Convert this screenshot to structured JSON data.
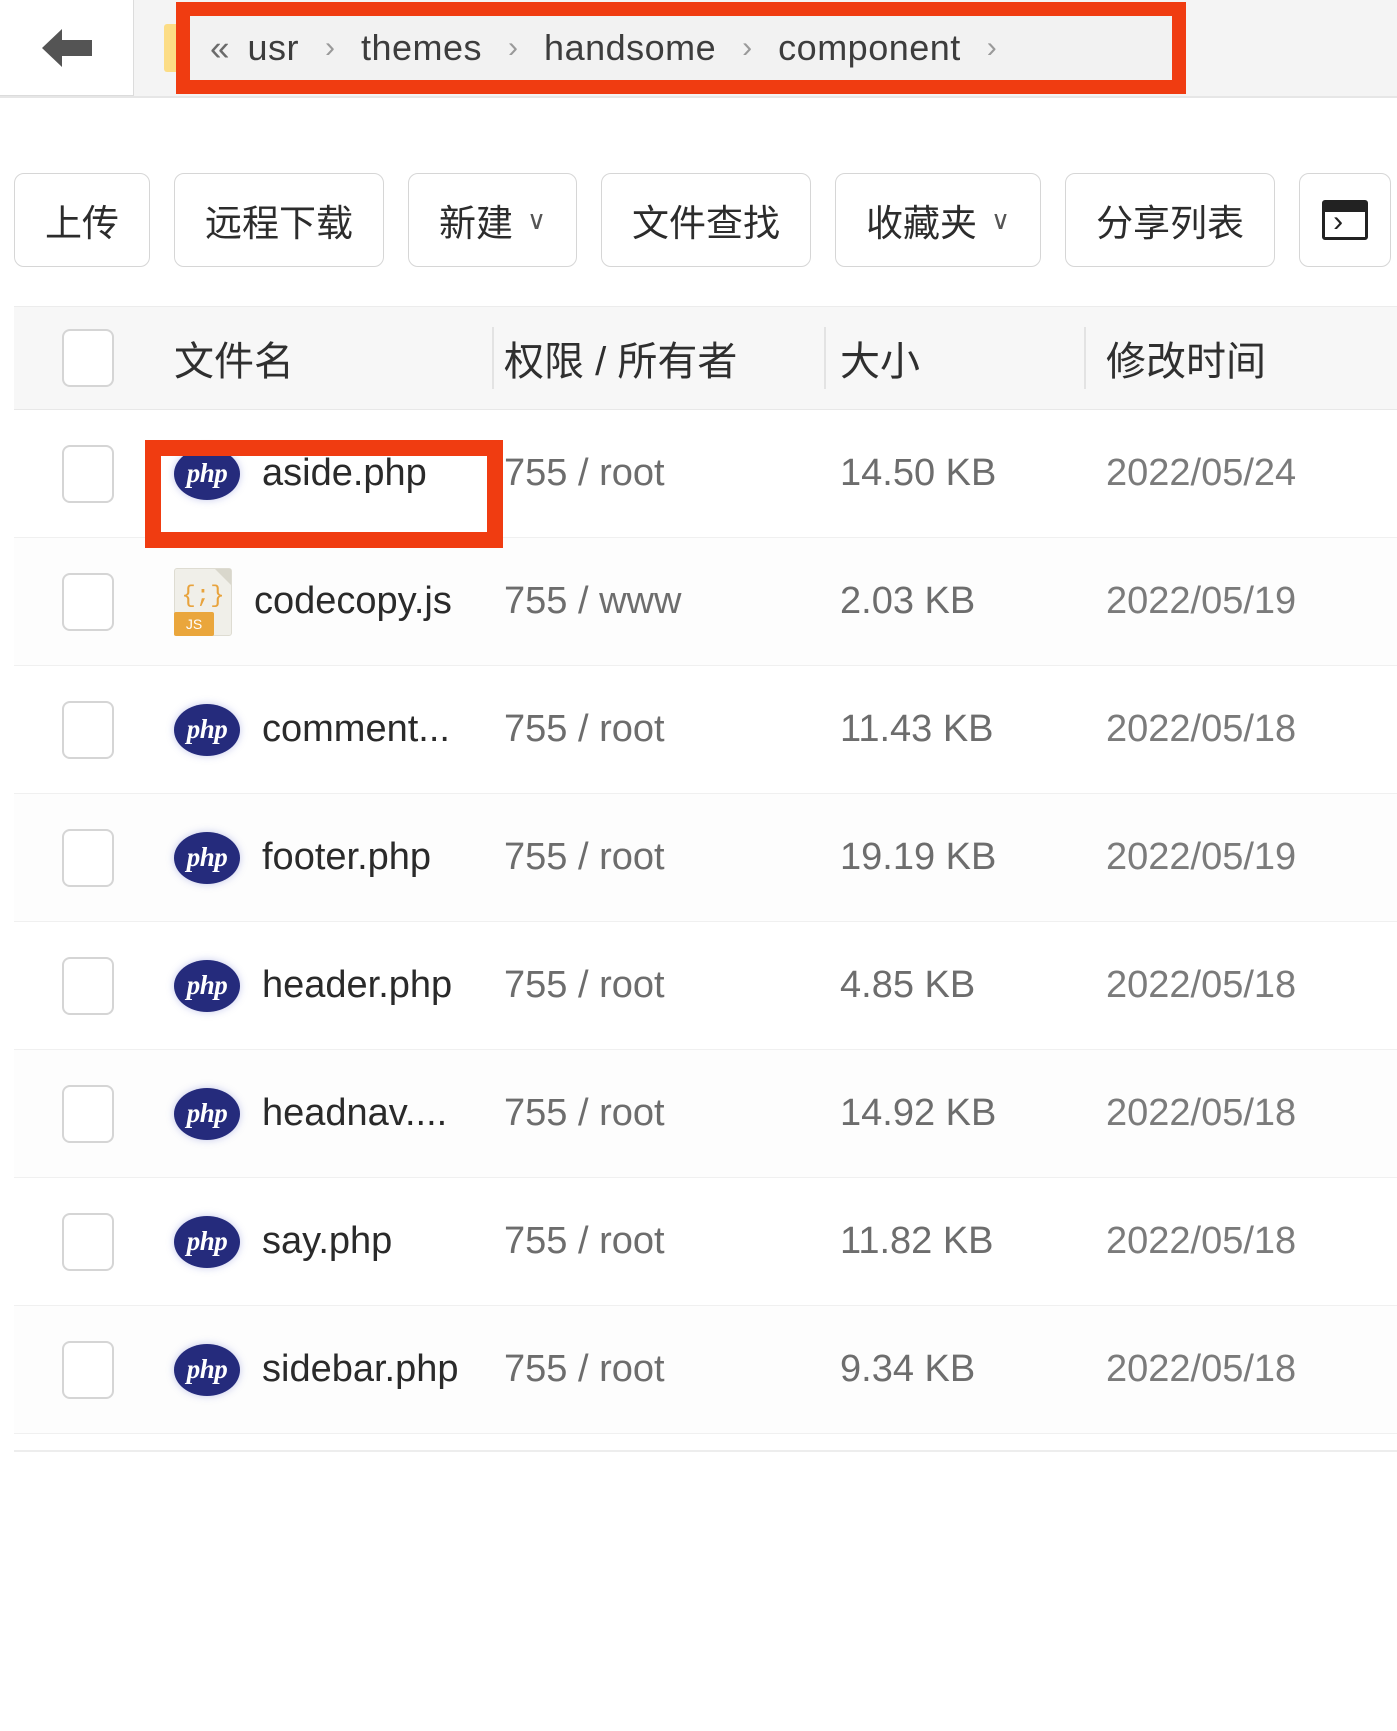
{
  "nav": {
    "back_icon": "arrow-left-icon",
    "folder_icon": "folder-icon",
    "breadcrumb_collapse": "«",
    "breadcrumb": [
      "usr",
      "themes",
      "handsome",
      "component"
    ],
    "separator": "›",
    "trailing_separator": "›"
  },
  "toolbar": {
    "upload": "上传",
    "remote_download": "远程下载",
    "new": "新建",
    "file_search": "文件查找",
    "favorites": "收藏夹",
    "share_list": "分享列表",
    "chevron": "∨",
    "terminal_icon": "terminal-icon"
  },
  "table": {
    "headers": {
      "filename": "文件名",
      "permission_owner": "权限 / 所有者",
      "size": "大小",
      "modified": "修改时间"
    },
    "rows": [
      {
        "icon": "php-file-icon",
        "icon_label": "php",
        "name": "aside.php",
        "perm": "755 / root",
        "size": "14.50 KB",
        "time": "2022/05/24"
      },
      {
        "icon": "js-file-icon",
        "icon_label": "JS",
        "name": "codecopy.js",
        "perm": "755 / www",
        "size": "2.03 KB",
        "time": "2022/05/19"
      },
      {
        "icon": "php-file-icon",
        "icon_label": "php",
        "name": "comment...",
        "perm": "755 / root",
        "size": "11.43 KB",
        "time": "2022/05/18"
      },
      {
        "icon": "php-file-icon",
        "icon_label": "php",
        "name": "footer.php",
        "perm": "755 / root",
        "size": "19.19 KB",
        "time": "2022/05/19"
      },
      {
        "icon": "php-file-icon",
        "icon_label": "php",
        "name": "header.php",
        "perm": "755 / root",
        "size": "4.85 KB",
        "time": "2022/05/18"
      },
      {
        "icon": "php-file-icon",
        "icon_label": "php",
        "name": "headnav....",
        "perm": "755 / root",
        "size": "14.92 KB",
        "time": "2022/05/18"
      },
      {
        "icon": "php-file-icon",
        "icon_label": "php",
        "name": "say.php",
        "perm": "755 / root",
        "size": "11.82 KB",
        "time": "2022/05/18"
      },
      {
        "icon": "php-file-icon",
        "icon_label": "php",
        "name": "sidebar.php",
        "perm": "755 / root",
        "size": "9.34 KB",
        "time": "2022/05/18"
      }
    ]
  },
  "annotations": {
    "color": "#f03c11",
    "breadcrumb_highlight": "breadcrumb-highlight",
    "file_highlight": "aside-php-highlight"
  }
}
